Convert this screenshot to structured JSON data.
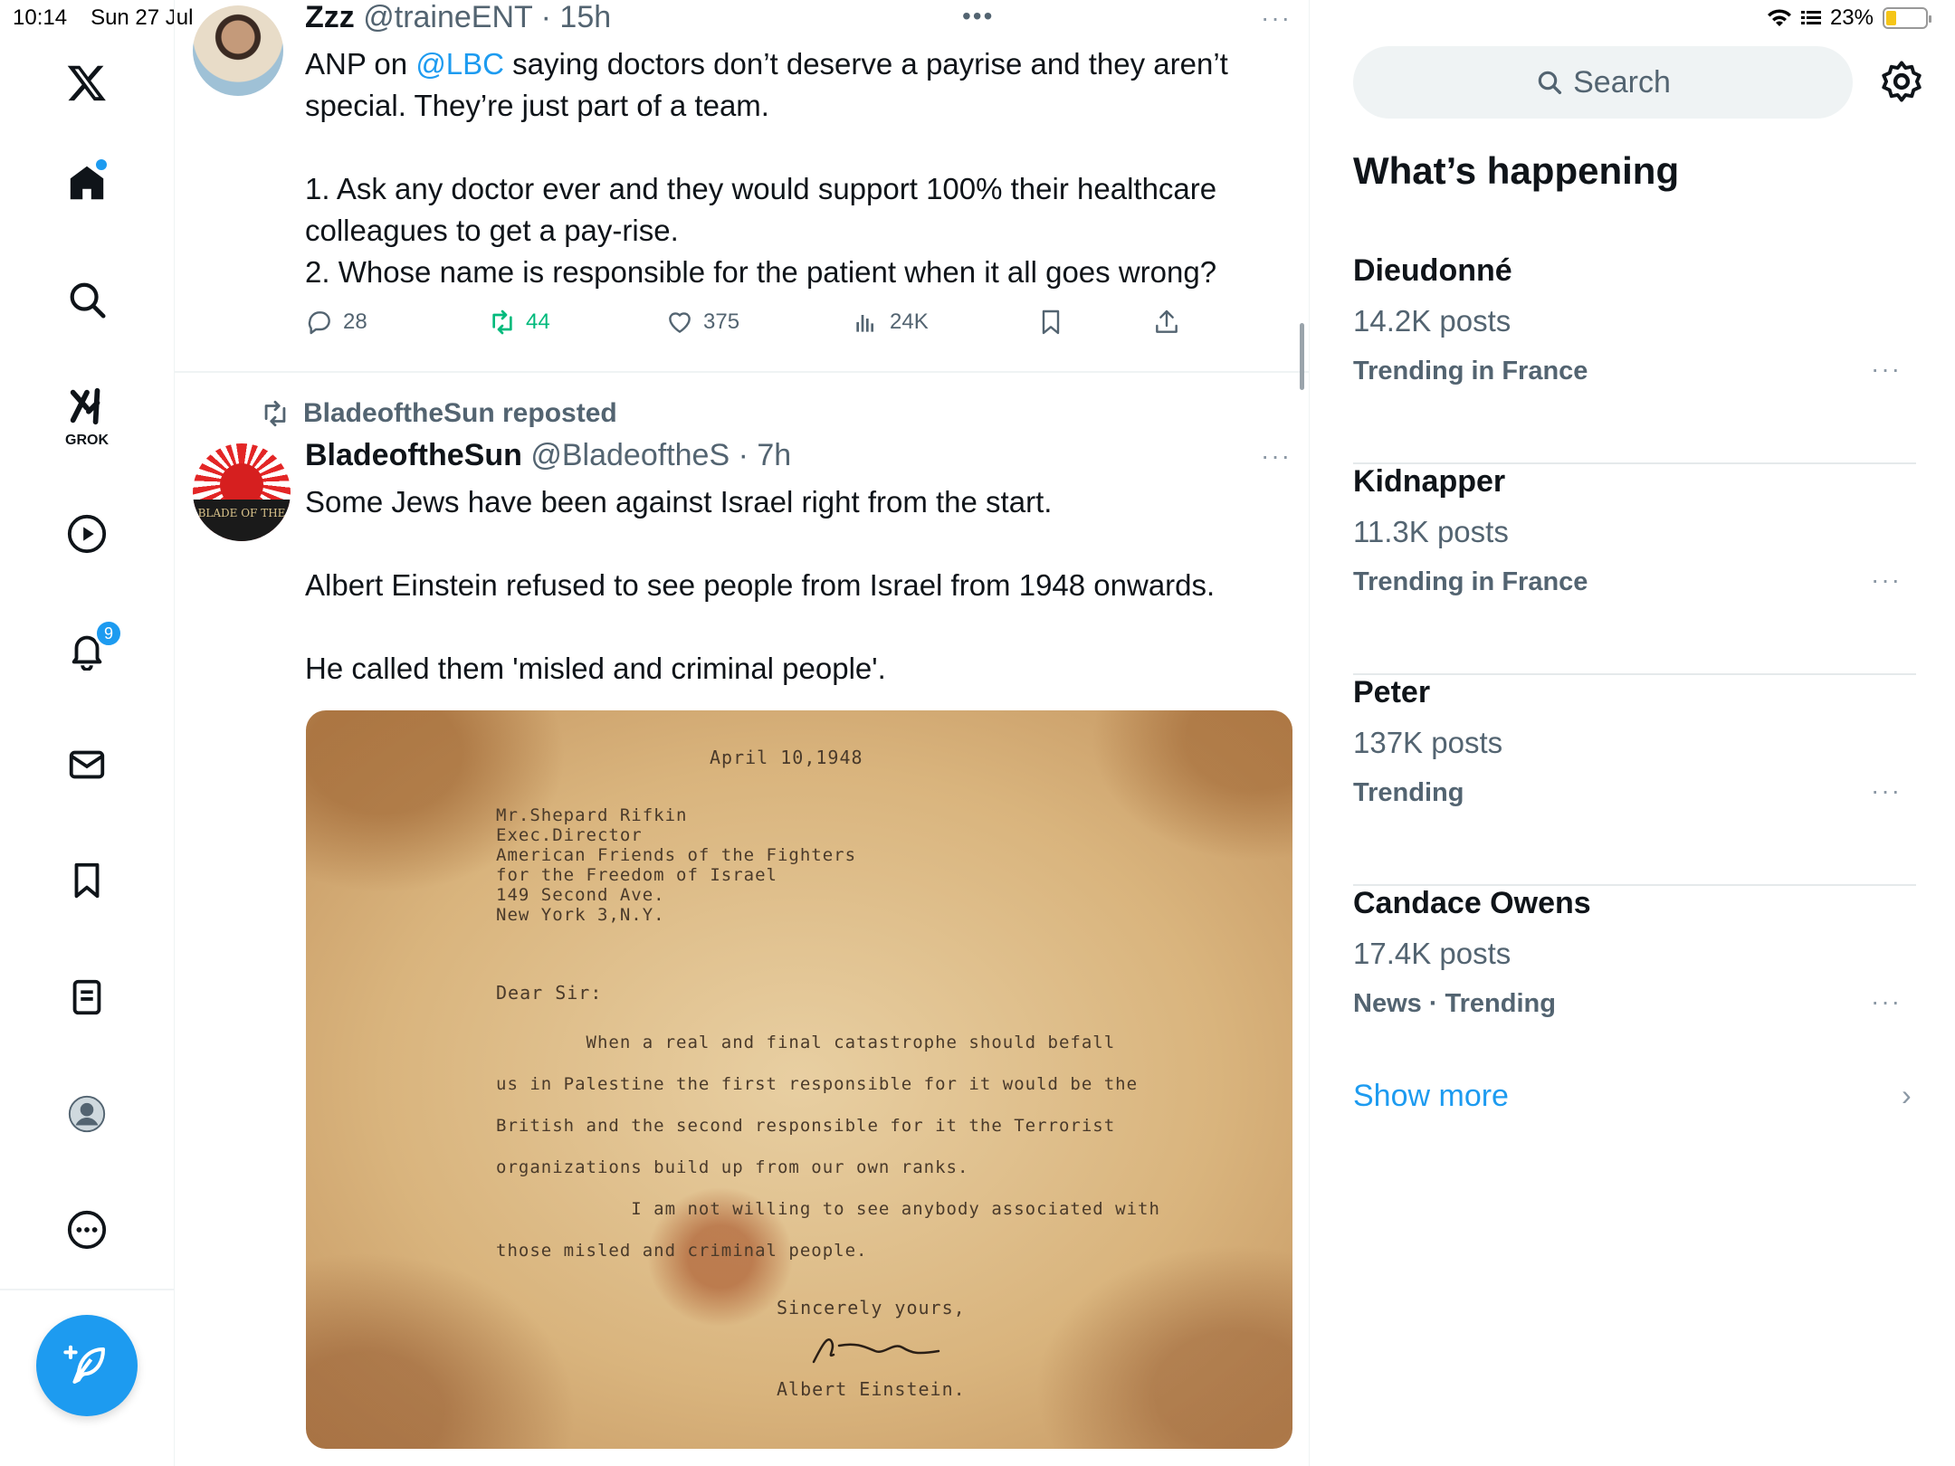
{
  "status_bar": {
    "time": "10:14",
    "date": "Sun 27 Jul",
    "battery": "23%",
    "battery_level": 0.23
  },
  "nav": {
    "grok_label": "GROK",
    "notifications_count": "9"
  },
  "tweet1": {
    "name": "Zzz",
    "handle": "@traineENT",
    "time": "· 15h",
    "text_part1": "ANP on ",
    "mention": "@LBC",
    "text_part2": " saying doctors don’t deserve a payrise and they aren’t special. They’re just part of a team.\n\n1. Ask any doctor ever and they would support 100% their healthcare colleagues to get a pay-rise.\n2. Whose name is responsible for the patient when it all goes wrong?",
    "replies": "28",
    "reposts": "44",
    "likes": "375",
    "views": "24K",
    "top_dots": "•••",
    "more": "···"
  },
  "tweet2": {
    "repost_label": "BladeoftheSun reposted",
    "name": "BladeoftheSun",
    "handle": "@BladeoftheS",
    "time": "· 7h",
    "more": "···",
    "avatar_text": "BLADE OF THE",
    "text": "Some Jews have been against Israel right from the start.\n\nAlbert Einstein refused to see people from Israel from 1948 onwards.\n\nHe called them 'misled and criminal people'.",
    "image": {
      "date": "April 10,1948",
      "address": "Mr.Shepard Rifkin\nExec.Director\nAmerican Friends of the Fighters\nfor the Freedom of Israel\n149 Second Ave.\nNew York 3,N.Y.",
      "salutation": "Dear Sir:",
      "body": "        When a real and final catastrophe should befall\nus in Palestine the first responsible for it would be the\nBritish and the second responsible for it the Terrorist\norganizations build up from our own ranks.\n            I am not willing to see anybody associated with\nthose misled and criminal people.",
      "closing": "Sincerely yours,",
      "signature_name": "Albert Einstein."
    }
  },
  "sidebar": {
    "search_placeholder": "Search",
    "title": "What’s happening",
    "trends": [
      {
        "name": "Dieudonné",
        "posts": "14.2K posts",
        "context": "Trending in France"
      },
      {
        "name": "Kidnapper",
        "posts": "11.3K posts",
        "context": "Trending in France"
      },
      {
        "name": "Peter",
        "posts": "137K posts",
        "context": "Trending"
      },
      {
        "name": "Candace Owens",
        "posts": "17.4K posts",
        "context": "News · Trending"
      }
    ],
    "trend_more": "···",
    "show_more": "Show more",
    "chevron": "›"
  },
  "colors": {
    "accent": "#1d9bf0",
    "repost_green": "#00ba7c",
    "muted": "#536471"
  }
}
